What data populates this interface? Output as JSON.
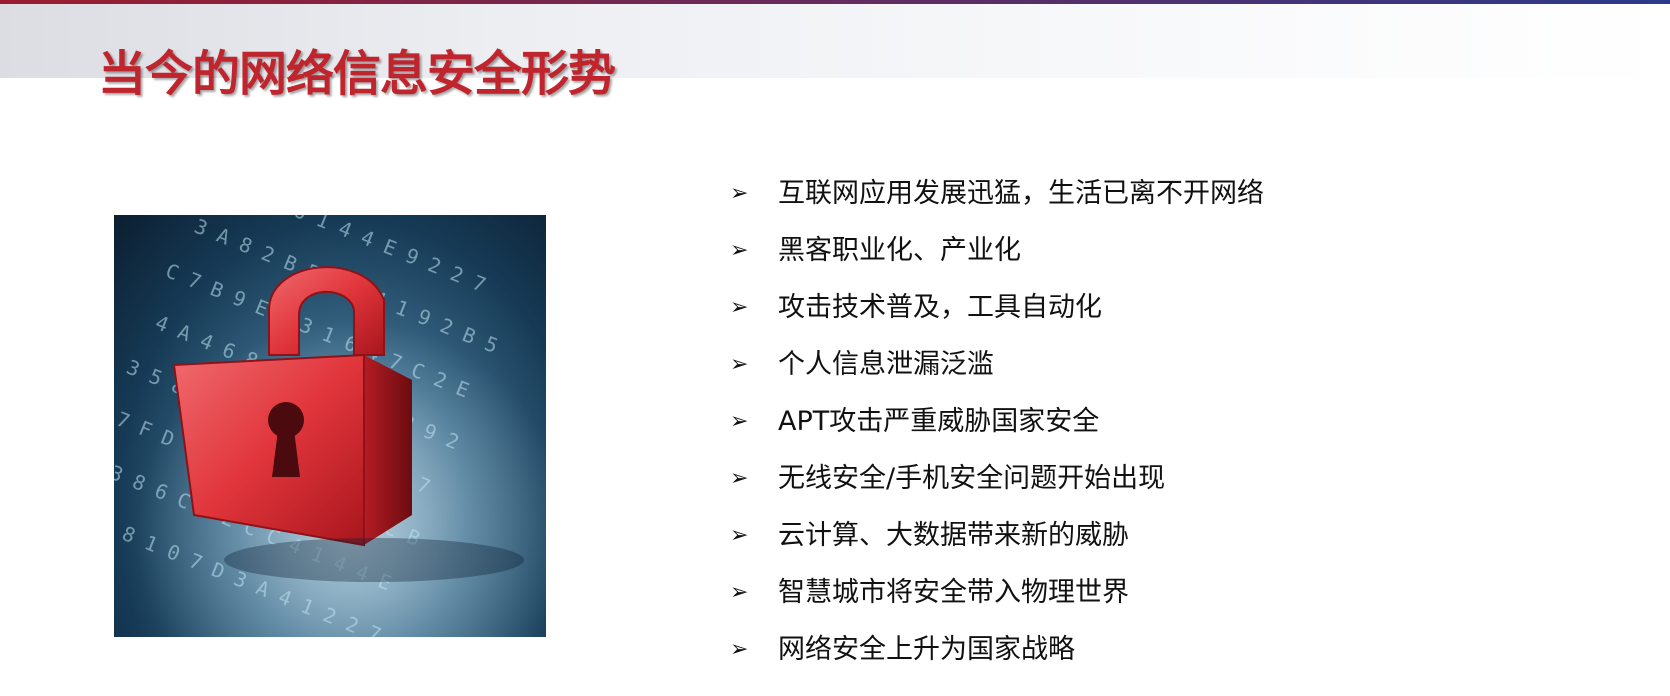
{
  "slide": {
    "title": "当今的网络信息安全形势"
  },
  "bullets": [
    "互联网应用发展迅猛，生活已离不开网络",
    "黑客职业化、产业化",
    "攻击技术普及，工具自动化",
    "个人信息泄漏泛滥",
    "APT攻击严重威胁国家安全",
    "无线安全/手机安全问题开始出现",
    "云计算、大数据带来新的威胁",
    "智慧城市将安全带入物理世界",
    "网络安全上升为国家战略"
  ],
  "bullet_icon": "arrowhead-bullet-icon",
  "colors": {
    "title": "#c0242c",
    "text": "#111111",
    "lock": "#e0353b"
  },
  "picture": {
    "subject": "lock-icon",
    "glyph_rows": [
      "0 2 B 3 6 1 4 4 E 9 2 2 7",
      "3 A 8 2 B 5 2 1 4 1 9 2 B 5",
      "C 7 B 9 E 8 3 1 6 4 7 C 2 E",
      "4 A 4 6 8 D 6 0 8 C 1 B 9 2",
      "3 5 8 9 A B 8 1 5 1 F 0 0 7",
      "7 F D 0 5 2 E A 5 3 2 5 C B",
      "6 3 8 6 C 4 2 C C 4 1 4 4 E",
      "1 1 8 1 0 7 D 3 A 4 1 2 2 7"
    ]
  }
}
